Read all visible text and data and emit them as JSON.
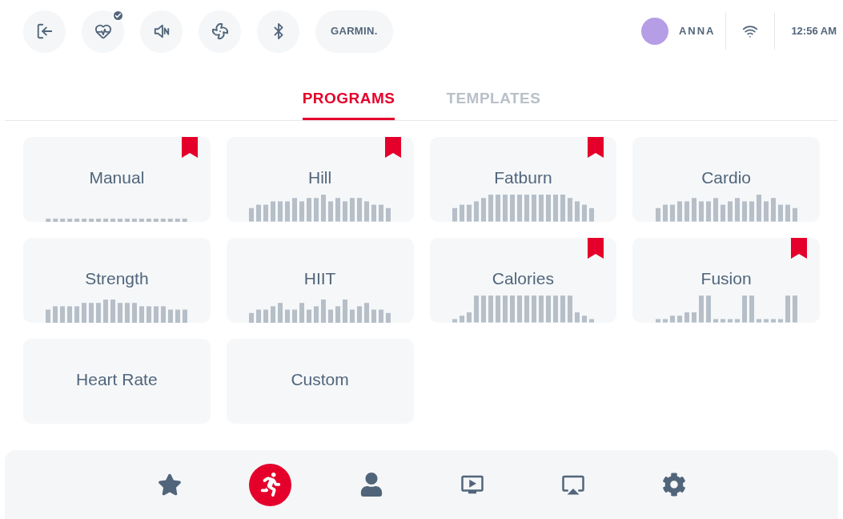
{
  "top_bar": {
    "heart_rate_connected": true,
    "brand": "GARMIN.",
    "user": "ANNA",
    "time": "12:56 AM"
  },
  "tabs": [
    {
      "label": "PROGRAMS",
      "selected": true
    },
    {
      "label": "TEMPLATES",
      "selected": false
    }
  ],
  "programs": [
    {
      "name": "Manual",
      "bookmarked": true,
      "kind": "flat"
    },
    {
      "name": "Hill",
      "bookmarked": true,
      "kind": "hill"
    },
    {
      "name": "Fatburn",
      "bookmarked": true,
      "kind": "plateau"
    },
    {
      "name": "Cardio",
      "bookmarked": false,
      "kind": "wave"
    },
    {
      "name": "Strength",
      "bookmarked": false,
      "kind": "strength"
    },
    {
      "name": "HIIT",
      "bookmarked": false,
      "kind": "intervals"
    },
    {
      "name": "Calories",
      "bookmarked": true,
      "kind": "ramp"
    },
    {
      "name": "Fusion",
      "bookmarked": true,
      "kind": "blocks"
    },
    {
      "name": "Heart Rate",
      "bookmarked": false,
      "kind": "none"
    },
    {
      "name": "Custom",
      "bookmarked": false,
      "kind": "none"
    }
  ],
  "bottom_nav": [
    {
      "selected": false
    },
    {
      "selected": true
    },
    {
      "selected": false
    },
    {
      "selected": false
    },
    {
      "selected": false
    },
    {
      "selected": false
    }
  ]
}
